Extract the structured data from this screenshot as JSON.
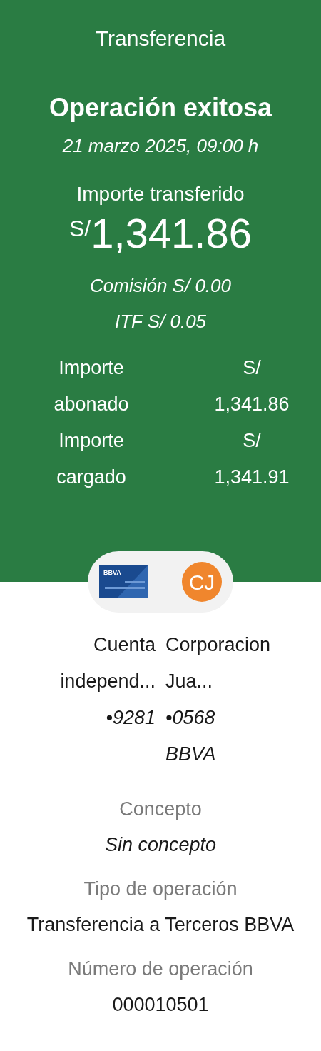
{
  "header": {
    "title": "Transferencia",
    "status": "Operación exitosa",
    "date": "21 marzo 2025, 09:00 h",
    "amount_label": "Importe transferido",
    "currency": "S/",
    "amount": "1,341.86",
    "commission": "Comisión S/ 0.00",
    "itf": "ITF S/ 0.05"
  },
  "summary": [
    {
      "label": "Importe abonado",
      "value": "S/ 1,341.86"
    },
    {
      "label": "Importe cargado",
      "value": "S/ 1,341.91"
    }
  ],
  "origin": {
    "name": "Cuenta independ...",
    "account": "•9281"
  },
  "destination": {
    "initials": "CJ",
    "name": "Corporacion Jua...",
    "account": "•0568",
    "bank": "BBVA"
  },
  "card": {
    "brand": "BBVA"
  },
  "details": [
    {
      "label": "Concepto",
      "value": "Sin concepto",
      "italic": true
    },
    {
      "label": "Tipo de operación",
      "value": "Transferencia a Terceros BBVA",
      "italic": false
    },
    {
      "label": "Número de operación",
      "value": "000010501",
      "italic": false
    }
  ]
}
